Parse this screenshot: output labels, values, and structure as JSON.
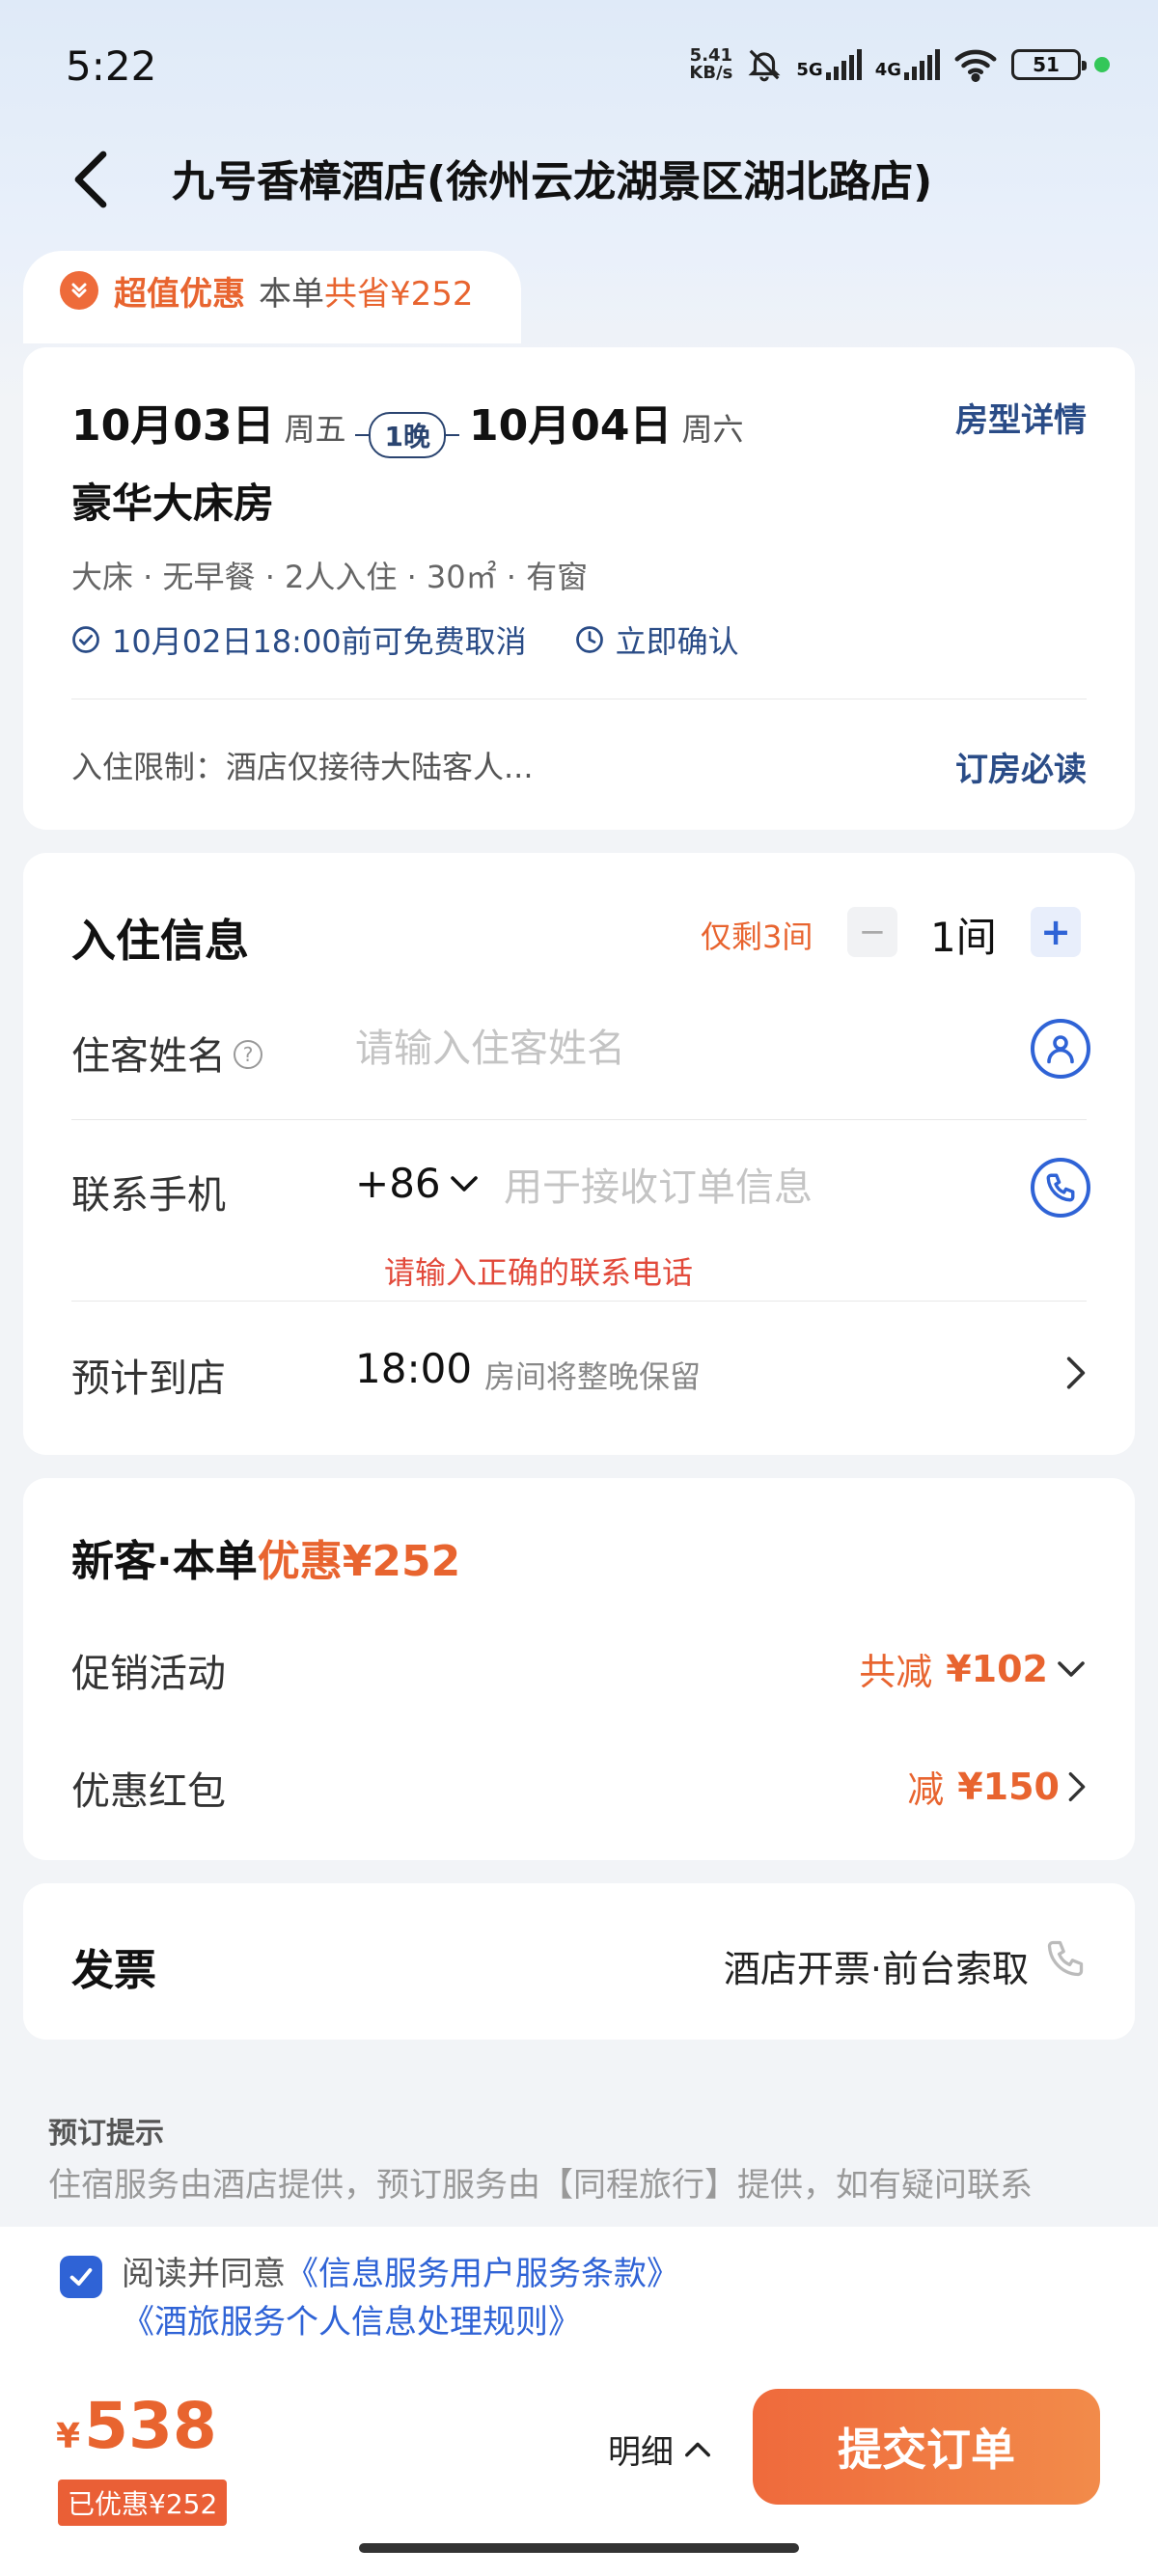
{
  "status_bar": {
    "time": "5:22",
    "net_speed_value": "5.41",
    "net_speed_unit": "KB/s",
    "signal_1": "5G",
    "signal_2": "4G",
    "battery": "51"
  },
  "header": {
    "title": "九号香樟酒店(徐州云龙湖景区湖北路店)"
  },
  "promo": {
    "label": "超值优惠",
    "text": "本单",
    "save": "共省¥252"
  },
  "booking": {
    "checkin_date": "10月03日",
    "checkin_week": "周五",
    "nights": "1晚",
    "checkout_date": "10月04日",
    "checkout_week": "周六",
    "room_detail_link": "房型详情",
    "room_name": "豪华大床房",
    "room_specs": "大床 · 无早餐 · 2人入住 · 30㎡ · 有窗",
    "cancel_policy": "10月02日18:00前可免费取消",
    "confirm_policy": "立即确认",
    "restriction": "入住限制：酒店仅接待大陆客人...",
    "must_read": "订房必读"
  },
  "guest": {
    "title": "入住信息",
    "stock_left": "仅剩3间",
    "minus": "−",
    "quantity": "1间",
    "plus": "+",
    "name_label": "住客姓名",
    "name_placeholder": "请输入住客姓名",
    "phone_label": "联系手机",
    "country_code": "+86",
    "phone_placeholder": "用于接收订单信息",
    "phone_error": "请输入正确的联系电话",
    "arrival_label": "预计到店",
    "arrival_time": "18:00",
    "arrival_note": "房间将整晚保留"
  },
  "discount": {
    "title_prefix": "新客·本单",
    "title_highlight": "优惠¥252",
    "promo_label": "促销活动",
    "promo_value_label": "共减",
    "promo_value_amount": "¥102",
    "coupon_label": "优惠红包",
    "coupon_value_label": "减",
    "coupon_value_amount": "¥150"
  },
  "invoice": {
    "title": "发票",
    "value": "酒店开票·前台索取"
  },
  "tips": {
    "title": "预订提示",
    "body": "住宿服务由酒店提供，预订服务由【同程旅行】提供，如有疑问联系"
  },
  "bottom": {
    "agree_prefix": "阅读并同意",
    "agree_link1": "《信息服务用户服务条款》",
    "agree_link2": "《酒旅服务个人信息处理规则》",
    "currency": "¥",
    "price": "538",
    "saved": "已优惠¥252",
    "detail": "明细",
    "submit": "提交订单"
  },
  "colors": {
    "accent_orange": "#e8642f",
    "link_blue": "#2a4c87",
    "action_blue": "#2f63d6",
    "error_red": "#e24a3b"
  }
}
